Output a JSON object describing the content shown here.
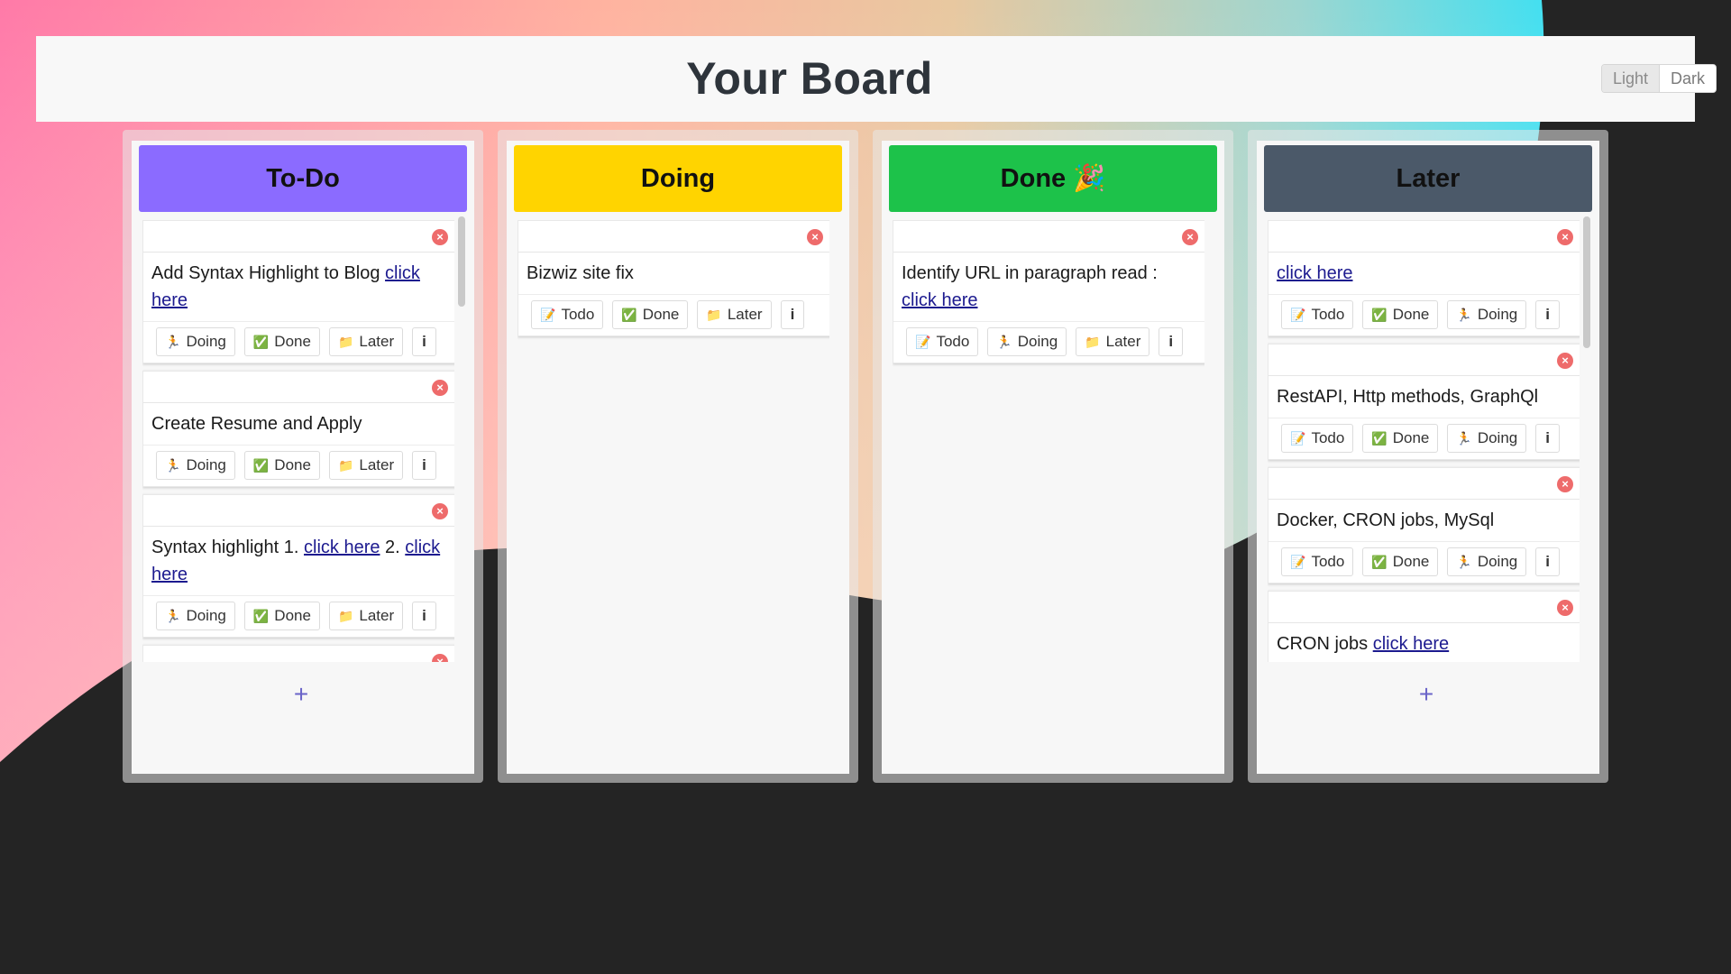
{
  "header": {
    "title": "Your Board"
  },
  "theme": {
    "light": "Light",
    "dark": "Dark"
  },
  "columns": [
    {
      "title": "To-Do",
      "color": "#8b6bff",
      "add": "+",
      "cards": [
        {
          "parts": [
            "Add Syntax Highlight to Blog ",
            "click here"
          ],
          "actions": [
            "Doing",
            "Done",
            "Later"
          ]
        },
        {
          "parts": [
            "Create Resume and Apply"
          ],
          "actions": [
            "Doing",
            "Done",
            "Later"
          ]
        },
        {
          "parts": [
            "Syntax highlight 1. ",
            "click here",
            " 2. ",
            "click here"
          ],
          "actions": [
            "Doing",
            "Done",
            "Later"
          ]
        },
        {
          "parts": [
            ""
          ],
          "actions": []
        }
      ]
    },
    {
      "title": "Doing",
      "color": "#ffd400",
      "cards": [
        {
          "parts": [
            "Bizwiz site fix"
          ],
          "actions": [
            "Todo",
            "Done",
            "Later"
          ]
        }
      ]
    },
    {
      "title": "Done 🎉",
      "color": "#1dc24a",
      "cards": [
        {
          "parts": [
            "Identify URL in paragraph read : ",
            "click here"
          ],
          "actions": [
            "Todo",
            "Doing",
            "Later"
          ]
        }
      ]
    },
    {
      "title": "Later",
      "color": "#4b5969",
      "add": "+",
      "cards": [
        {
          "parts": [
            "",
            "click here"
          ],
          "actions": [
            "Todo",
            "Done",
            "Doing"
          ]
        },
        {
          "parts": [
            "RestAPI, Http methods, GraphQl"
          ],
          "actions": [
            "Todo",
            "Done",
            "Doing"
          ]
        },
        {
          "parts": [
            "Docker, CRON jobs, MySql"
          ],
          "actions": [
            "Todo",
            "Done",
            "Doing"
          ]
        },
        {
          "parts": [
            "CRON jobs ",
            "click here"
          ],
          "actions": []
        }
      ]
    }
  ],
  "icons": {
    "Todo": "memo-icon",
    "Doing": "runner-icon",
    "Done": "checkmark-icon",
    "Later": "folder-icon",
    "info": "info-icon",
    "delete": "close-circle-icon",
    "add": "plus-icon"
  },
  "labels": {
    "info": "i",
    "delete": "×"
  }
}
